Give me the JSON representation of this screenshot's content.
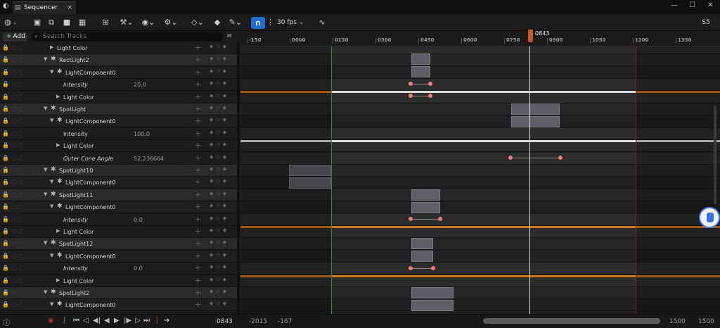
{
  "titlebar": {
    "tab_label": "Sequencer",
    "tab_close": "×",
    "minimize": "—",
    "maximize": "☐",
    "close": "✕"
  },
  "toolbar": {
    "fps_label": "30 fps",
    "snap_icon": "magnet-icon",
    "right_label": "S5"
  },
  "tracks_header": {
    "add_label": "Add",
    "search_placeholder": "Search Tracks"
  },
  "ruler": {
    "ticks": [
      "-150",
      "0000",
      "0150",
      "0300",
      "0450",
      "0600",
      "0750",
      "0900",
      "1050",
      "1200",
      "1350"
    ],
    "playhead_label": "0843"
  },
  "tracks": [
    {
      "type": "prop",
      "indent": 1,
      "label": "Light Color",
      "value": ""
    },
    {
      "type": "obj",
      "indent": 0,
      "label": "RectLight2",
      "value": ""
    },
    {
      "type": "comp",
      "indent": 1,
      "label": "LightComponent0",
      "value": ""
    },
    {
      "type": "prop",
      "indent": 2,
      "label": "Intensity",
      "italic": true,
      "value": "20.0"
    },
    {
      "type": "prop",
      "indent": 2,
      "label": "Light Color",
      "value": ""
    },
    {
      "type": "obj",
      "indent": 0,
      "label": "SpotLight",
      "value": ""
    },
    {
      "type": "comp",
      "indent": 1,
      "label": "LightComponent0",
      "value": ""
    },
    {
      "type": "prop",
      "indent": 2,
      "label": "Intensity",
      "value": "100.0"
    },
    {
      "type": "prop",
      "indent": 2,
      "label": "Light Color",
      "value": ""
    },
    {
      "type": "prop",
      "indent": 2,
      "label": "Outer Cone Angle",
      "italic": true,
      "value": "52.236664"
    },
    {
      "type": "obj",
      "indent": 0,
      "label": "SpotLight10",
      "value": ""
    },
    {
      "type": "comp",
      "indent": 1,
      "label": "LightComponent0",
      "value": ""
    },
    {
      "type": "obj",
      "indent": 0,
      "label": "SpotLight11",
      "value": ""
    },
    {
      "type": "comp",
      "indent": 1,
      "label": "LightComponent0",
      "value": ""
    },
    {
      "type": "prop",
      "indent": 2,
      "label": "Intensity",
      "italic": true,
      "value": "0.0"
    },
    {
      "type": "prop",
      "indent": 2,
      "label": "Light Color",
      "value": ""
    },
    {
      "type": "obj",
      "indent": 0,
      "label": "SpotLight12",
      "value": ""
    },
    {
      "type": "comp",
      "indent": 1,
      "label": "LightComponent0",
      "value": ""
    },
    {
      "type": "prop",
      "indent": 2,
      "label": "Intensity",
      "italic": true,
      "value": "0.0"
    },
    {
      "type": "prop",
      "indent": 2,
      "label": "Light Color",
      "value": ""
    },
    {
      "type": "obj",
      "indent": 0,
      "label": "SpotLight2",
      "value": ""
    },
    {
      "type": "comp",
      "indent": 1,
      "label": "LightComponent0",
      "value": ""
    }
  ],
  "bottombar": {
    "frame": "0843",
    "range_start": "-2015",
    "range_view": "-167",
    "range_end_a": "1500",
    "range_end_b": "1500"
  },
  "colors": {
    "accent": "#1f6ed6",
    "curve": "#d3761a",
    "key": "#f07a7a"
  }
}
